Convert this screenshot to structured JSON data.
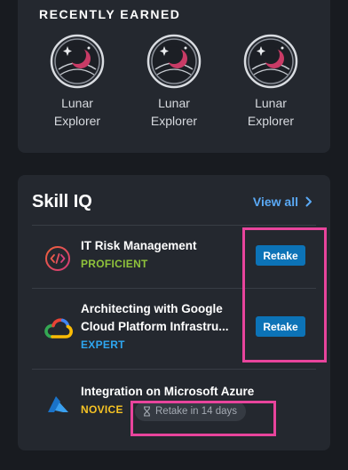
{
  "recently_earned": {
    "title": "RECENTLY EARNED",
    "badges": [
      {
        "label_line1": "Lunar",
        "label_line2": "Explorer",
        "icon": "lunar-explorer-badge-icon"
      },
      {
        "label_line1": "Lunar",
        "label_line2": "Explorer",
        "icon": "lunar-explorer-badge-icon"
      },
      {
        "label_line1": "Lunar",
        "label_line2": "Explorer",
        "icon": "lunar-explorer-badge-icon"
      }
    ]
  },
  "skill_iq": {
    "title": "Skill IQ",
    "view_all_label": "View all",
    "items": [
      {
        "name": "IT Risk Management",
        "level": "PROFICIENT",
        "level_color": "#8fc33b",
        "action_label": "Retake",
        "icon": "code-brackets-icon"
      },
      {
        "name_line1": "Architecting with Google",
        "name_line2": "Cloud Platform Infrastru...",
        "level": "EXPERT",
        "level_color": "#2ea6f0",
        "action_label": "Retake",
        "icon": "google-cloud-icon"
      },
      {
        "name": "Integration on Microsoft Azure",
        "level": "NOVICE",
        "level_color": "#f6c324",
        "retake_status": "Retake in 14 days",
        "icon": "microsoft-azure-icon"
      }
    ]
  },
  "colors": {
    "page_bg": "#181b20",
    "card_bg": "#24282f",
    "link": "#5aa9f5",
    "button": "#0c73b7",
    "highlight": "#e8449c"
  }
}
